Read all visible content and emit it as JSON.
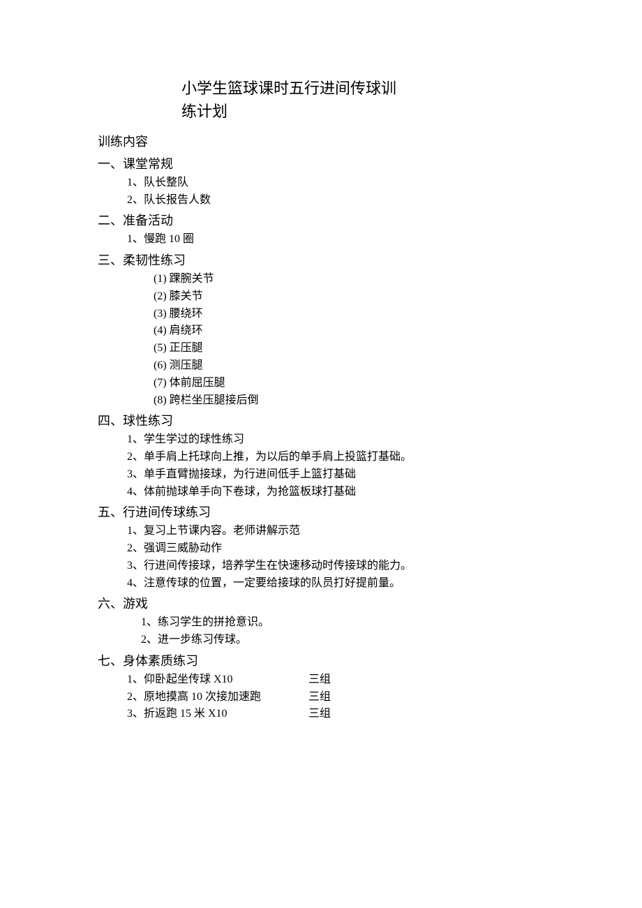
{
  "title_line1": "小学生篮球课时五行进间传球训",
  "title_line2": "练计划",
  "content_header": "训练内容",
  "sections": {
    "s1": {
      "header": "一、课堂常规",
      "items": [
        "1、队长整队",
        "2、队长报告人数"
      ]
    },
    "s2": {
      "header": "二、准备活动",
      "items": [
        "1、慢跑 10 圈"
      ]
    },
    "s3": {
      "header": "三、柔韧性练习",
      "items": [
        "(1) 踝腕关节",
        "(2) 膝关节",
        "(3) 腰绕环",
        "(4) 肩绕环",
        "(5) 正压腿",
        "(6) 测压腿",
        "(7) 体前屈压腿",
        "(8) 跨栏坐压腿接后倒"
      ]
    },
    "s4": {
      "header": "四、球性练习",
      "items": [
        "1、学生学过的球性练习",
        "2、单手肩上托球向上推，为以后的单手肩上投篮打基础。",
        "3、单手直臂抛接球，为行进间低手上篮打基础",
        "4、体前抛球单手向下卷球，为抢篮板球打基础"
      ]
    },
    "s5": {
      "header": "五、行进间传球练习",
      "items": [
        "1、复习上节课内容。老师讲解示范",
        "2、强调三威胁动作",
        "3、行进间传接球，培养学生在快速移动时传接球的能力。",
        "4、注意传球的位置，一定要给接球的队员打好提前量。"
      ]
    },
    "s6": {
      "header": "六、游戏",
      "items": [
        "1、练习学生的拼抢意识。",
        "2、进一步练习传球。"
      ]
    },
    "s7": {
      "header": "七、身体素质练习",
      "items": [
        {
          "label": "1、仰卧起坐传球 X10",
          "sets": "三组"
        },
        {
          "label": "2、原地摸高 10 次接加速跑",
          "sets": "三组"
        },
        {
          "label": "3、折返跑 15 米 X10",
          "sets": "三组"
        }
      ]
    }
  }
}
